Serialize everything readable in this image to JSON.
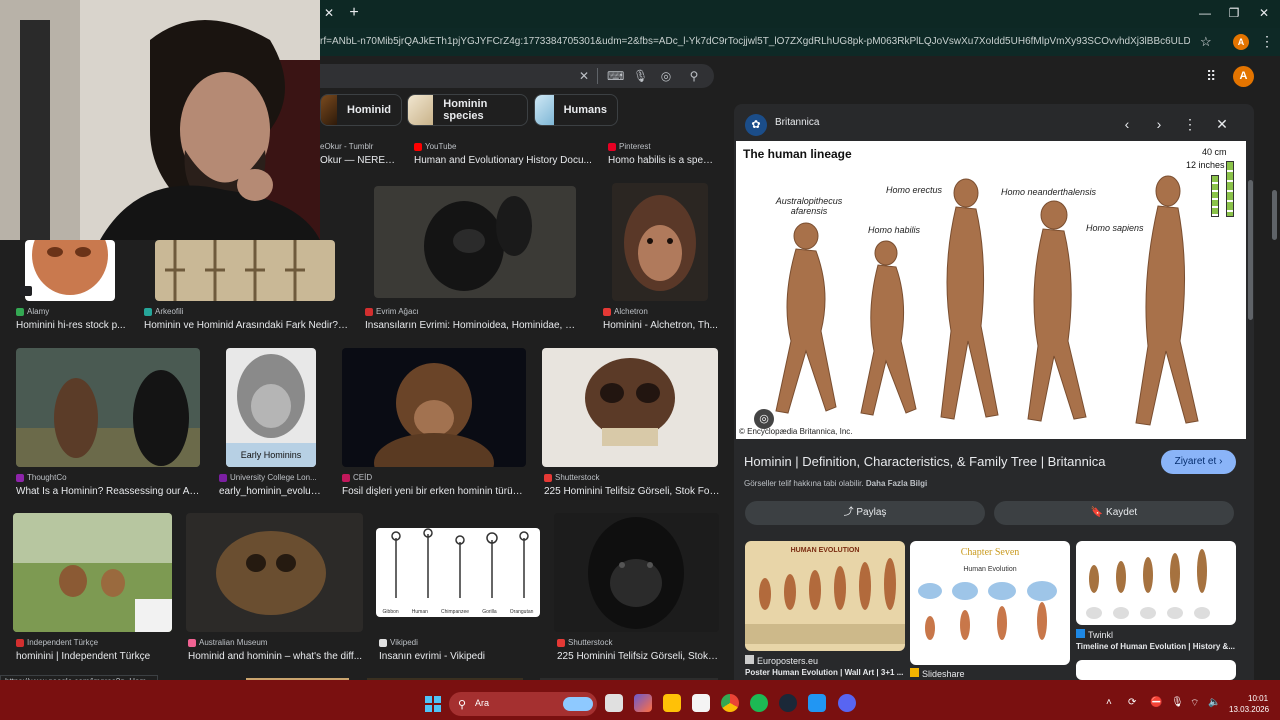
{
  "browser": {
    "url": "rf=ANbL-n70Mib5jrQAJkETh1pjYGJYFCrZ4g:1773384705301&udm=2&fbs=ADc_l-Yk7dC9rTocjjwl5T_lO7ZXgdRLhUG8pk-pM063RkPlLQJoVswXu7XoIdd5UH6fMlpVmXy93SCOvvhdXj3lBBc6ULDr0rdqW0XXkPsl2-Ji...",
    "avatar_letter": "A",
    "status_url": "https://www.google.com/imgres?q=Hom..."
  },
  "chips": [
    {
      "label": "Hominid"
    },
    {
      "label": "Hominin species"
    },
    {
      "label": "Humans"
    }
  ],
  "row0": [
    {
      "source": "eOkur - Tumblr",
      "title": "Okur — NERED..."
    },
    {
      "source": "YouTube",
      "title": "Human and Evolutionary History Docu..."
    },
    {
      "source": "Pinterest",
      "title": "Homo habilis is a speci..."
    }
  ],
  "row1": [
    {
      "source": "Alamy",
      "title": "Hominini hi-res stock p..."
    },
    {
      "source": "Arkeofili",
      "title": "Hominin ve Hominid Arasındaki Fark Nedir? -..."
    },
    {
      "source": "Evrim Ağacı",
      "title": "İnsansıların Evrimi: Hominoidea, Hominidae, Ho..."
    },
    {
      "source": "Alchetron",
      "title": "Hominini - Alchetron, Th..."
    }
  ],
  "row2": [
    {
      "source": "ThoughtCo",
      "title": "What Is a Hominin? Reassessing our An..."
    },
    {
      "source": "University College Lon...",
      "title": "early_hominin_evoluti...",
      "caption": "Early Hominins"
    },
    {
      "source": "CEİD",
      "title": "Fosil dişleri yeni bir erken hominin türün..."
    },
    {
      "source": "Shutterstock",
      "title": "225 Hominini Telifsiz Görseli, Stok Fot..."
    }
  ],
  "row3": [
    {
      "source": "Independent Türkçe",
      "title": "hominini | Independent Türkçe"
    },
    {
      "source": "Australian Museum",
      "title": "Hominid and hominin – what's the diff..."
    },
    {
      "source": "Vikipedi",
      "title": "İnsanın evrimi - Vikipedi",
      "labels": [
        "Gibbon",
        "Human",
        "Chimpanzee",
        "Gorilla",
        "Orangutan"
      ]
    },
    {
      "source": "Shutterstock",
      "title": "225 Hominini Telifsiz Görseli, Stok ..."
    }
  ],
  "panel": {
    "site": "Britannica",
    "title": "Hominin | Definition, Characteristics, & Family Tree | Britannica",
    "visit_label": "Ziyaret et",
    "note": "Görseller telif hakkına tabi olabilir.",
    "note_link": "Daha Fazla Bilgi",
    "share_label": "Paylaş",
    "save_label": "Kaydet",
    "image": {
      "heading": "The human lineage",
      "scale_cm": "40 cm",
      "scale_in": "12 inches",
      "species": [
        "Australopithecus afarensis",
        "Homo habilis",
        "Homo erectus",
        "Homo neanderthalensis",
        "Homo sapiens"
      ],
      "credit": "© Encyclopædia Britannica, Inc."
    },
    "related": [
      {
        "source": "Europosters.eu",
        "title": "Poster Human Evolution | Wall Art | 3+1 ...",
        "banner": "HUMAN EVOLUTION"
      },
      {
        "source": "Slideshare",
        "title": "",
        "heading": "Chapter Seven",
        "sub": "Human Evolution"
      },
      {
        "source": "Twinkl",
        "title": "Timeline of Human Evolution | History &..."
      }
    ]
  },
  "taskbar": {
    "search_placeholder": "Ara",
    "time": "10:01",
    "date": "13.03.2026"
  }
}
